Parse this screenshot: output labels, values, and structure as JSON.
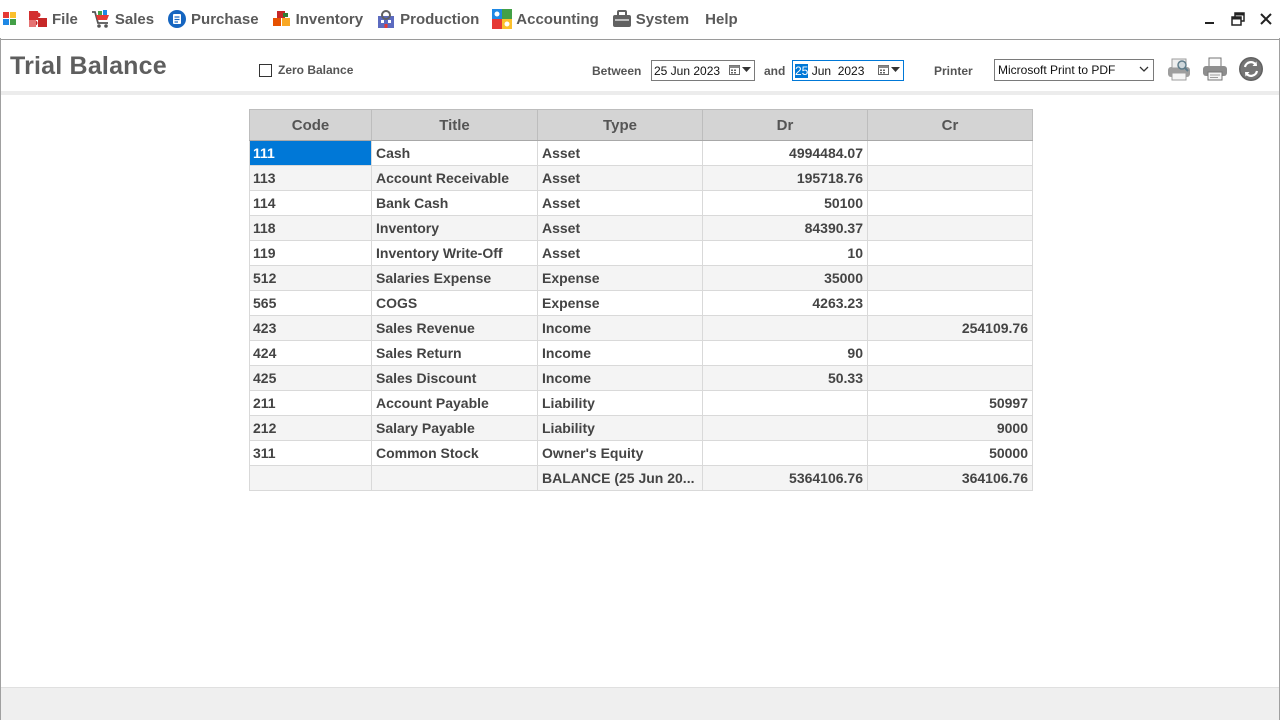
{
  "menu": {
    "items": [
      {
        "label": "File",
        "icon": "file-puzzle-icon"
      },
      {
        "label": "Sales",
        "icon": "shopping-cart-icon"
      },
      {
        "label": "Purchase",
        "icon": "purchase-document-icon"
      },
      {
        "label": "Inventory",
        "icon": "inventory-boxes-icon"
      },
      {
        "label": "Production",
        "icon": "production-factory-icon"
      },
      {
        "label": "Accounting",
        "icon": "accounting-icon"
      },
      {
        "label": "System",
        "icon": "system-toolbox-icon"
      },
      {
        "label": "Help",
        "icon": ""
      }
    ]
  },
  "toolbar": {
    "title": "Trial Balance",
    "zero_balance_label": "Zero Balance",
    "zero_balance_checked": false,
    "between_label": "Between",
    "date_from": "25 Jun  2023",
    "and_label": "and",
    "date_to_day": "25",
    "date_to_rest": " Jun  2023",
    "printer_label": "Printer",
    "printer_value": "Microsoft Print to PDF"
  },
  "grid": {
    "columns": [
      "Code",
      "Title",
      "Type",
      "Dr",
      "Cr"
    ],
    "rows": [
      {
        "code": "111",
        "title": "Cash",
        "type": "Asset",
        "dr": "4994484.07",
        "cr": ""
      },
      {
        "code": "113",
        "title": "Account Receivable",
        "type": "Asset",
        "dr": "195718.76",
        "cr": ""
      },
      {
        "code": "114",
        "title": "Bank Cash",
        "type": "Asset",
        "dr": "50100",
        "cr": ""
      },
      {
        "code": "118",
        "title": "Inventory",
        "type": "Asset",
        "dr": "84390.37",
        "cr": ""
      },
      {
        "code": "119",
        "title": "Inventory Write-Off",
        "type": "Asset",
        "dr": "10",
        "cr": ""
      },
      {
        "code": "512",
        "title": "Salaries Expense",
        "type": "Expense",
        "dr": "35000",
        "cr": ""
      },
      {
        "code": "565",
        "title": "COGS",
        "type": "Expense",
        "dr": "4263.23",
        "cr": ""
      },
      {
        "code": "423",
        "title": "Sales Revenue",
        "type": "Income",
        "dr": "",
        "cr": "254109.76"
      },
      {
        "code": "424",
        "title": "Sales Return",
        "type": "Income",
        "dr": "90",
        "cr": ""
      },
      {
        "code": "425",
        "title": "Sales Discount",
        "type": "Income",
        "dr": "50.33",
        "cr": ""
      },
      {
        "code": "211",
        "title": "Account Payable",
        "type": "Liability",
        "dr": "",
        "cr": "50997"
      },
      {
        "code": "212",
        "title": "Salary Payable",
        "type": "Liability",
        "dr": "",
        "cr": "9000"
      },
      {
        "code": "311",
        "title": "Common Stock",
        "type": "Owner's Equity",
        "dr": "",
        "cr": "50000"
      },
      {
        "code": "",
        "title": "",
        "type": "BALANCE (25 Jun 20...",
        "dr": "5364106.76",
        "cr": "364106.76"
      }
    ],
    "selected_row": 0
  },
  "colors": {
    "selection": "#0078d7",
    "header_bg": "#d4d4d4",
    "text": "#444444"
  }
}
